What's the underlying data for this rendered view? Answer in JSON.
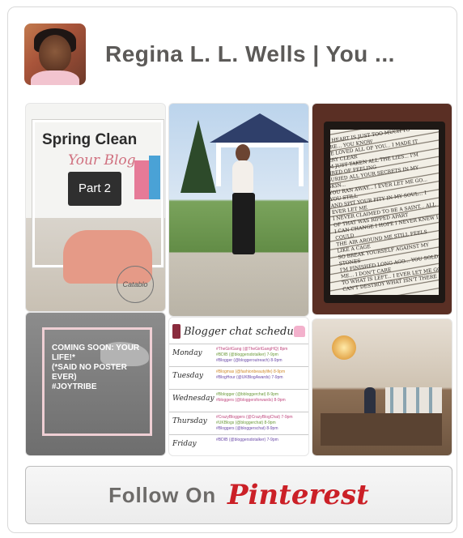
{
  "profile": {
    "name": "Regina L. L. Wells | You ...",
    "avatar_icon": "profile-photo"
  },
  "pins": [
    {
      "title_line1": "Spring Clean",
      "title_line2": "Your Blog",
      "laptop_text": "Part 2",
      "logo_text": "Catablo"
    },
    {
      "description": "Woman in white sweater and black culottes standing in a park with a gazebo"
    },
    {
      "text": "MY HEART IS JUST TOO MUCH TO CARE... YOU KNOW\nI'VE LOVED ALL OF YOU... I MADE IT VERY CLEAR\nI'M JUST TAKEN ALL THE LIES... I'M TIRED OF FEELING\nBURIED ALL YOUR SECRETS IN MY SKIN...\nYOU RAN AWAY... I EVER LET ME GO... YOU STILL\nAND SPIT YOUR PITY IN MY SOUL... I EVER LET ME\nI NEVER CLAIMED TO BE A SAINT... ALL OF THAT WAS RIPPED APART\nI CAN CHANGE I HOPE I NEVER KNEW I COULD\nTHE AIR AROUND ME STILL FEELS LIKE A CAGE\nSO BREAK YOURSELF AGAINST MY STONES\nI'M FINISHED LONG AGO... YOU SOLD ME... I DON'T CARE\nTO WHAT IS LEFT... I EVER LET ME GO\nCAN'T DESTROY WHAT ISN'T THERE"
    },
    {
      "text_line1": "COMING SOON: YOUR",
      "text_line2": "LIFE!*",
      "text_line3": "(*SAID NO POSTER",
      "text_line4": "EVER)",
      "text_line5": "#JOYTRIBE"
    },
    {
      "title": "Blogger chat schedule",
      "rows": [
        {
          "day": "Monday",
          "lines": [
            "#TheGirlGang (@TheGirlGangHQ) 8pm",
            "#BDIB (@bloggersdotalker) 7-9pm",
            "#Blogger (@bloggeroutreach) 8-9pm"
          ]
        },
        {
          "day": "Tuesday",
          "lines": [
            "#Blogmas (@fashionbeautylife) 8-9pm",
            "#BlogHour (@UKBlogAwards) 7-9pm"
          ]
        },
        {
          "day": "Wednesday",
          "lines": [
            "#Bblogger (@bbloggerchat) 8-9pm",
            "#bloggers (@bloggersforwards) 8-9pm"
          ]
        },
        {
          "day": "Thursday",
          "lines": [
            "#CrazyBloggers (@CrazyBlogChat) 7-9pm",
            "#UKBlogs (@bloggerchat) 8-9pm",
            "#Bloggers (@bloggerschat) 8-9pm"
          ]
        },
        {
          "day": "Friday",
          "lines": [
            "#BDIB (@bloggersdotalker) 7-9pm"
          ]
        }
      ]
    },
    {
      "description": "Boutique store interior with hanging lamps, clothing racks and a wooden counter"
    }
  ],
  "follow": {
    "label": "Follow On",
    "brand": "Pinterest",
    "brand_color": "#cb2027"
  }
}
